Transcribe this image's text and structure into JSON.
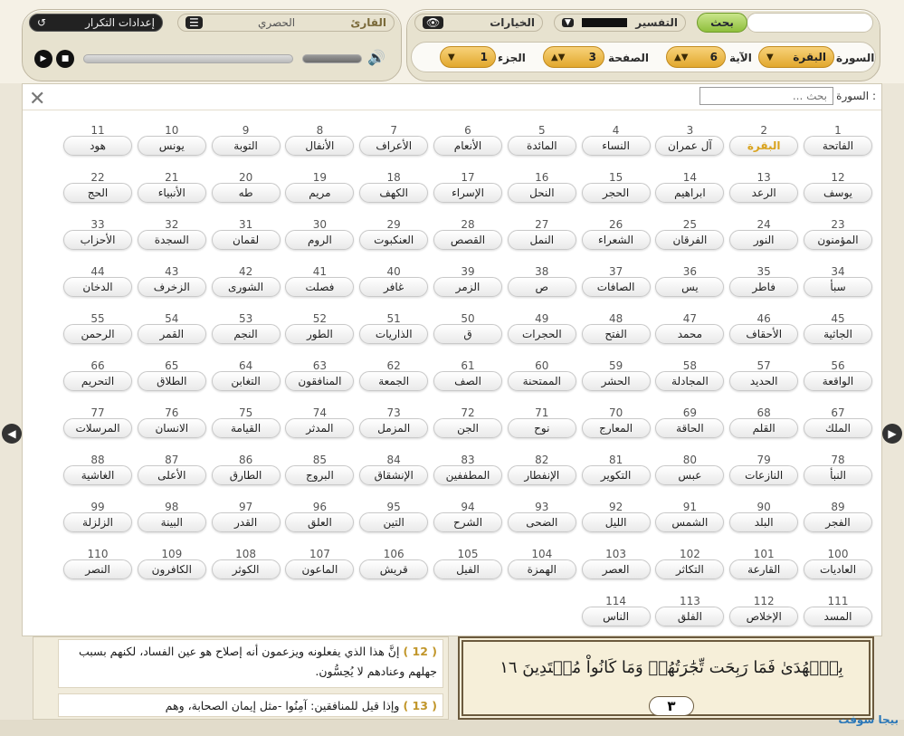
{
  "toolbar": {
    "search_btn": "بحث",
    "tafsir_label": "التفسير",
    "tafsir_value": "",
    "options_label": "الخيارات",
    "reader_label": "القارئ",
    "reader_value": "الحصري",
    "repeat_settings": "إعدادات التكرار",
    "sura_label": "السورة",
    "sura_value": "البقرة",
    "aya_label": "الآية",
    "aya_value": "6",
    "page_label": "الصفحة",
    "page_value": "3",
    "juz_label": "الجزء",
    "juz_value": "1"
  },
  "panel": {
    "search_label": "السورة :",
    "search_placeholder": "بحث ..."
  },
  "suras": [
    {
      "n": "1",
      "name": "الفاتحة"
    },
    {
      "n": "2",
      "name": "البقرة"
    },
    {
      "n": "3",
      "name": "آل عمران"
    },
    {
      "n": "4",
      "name": "النساء"
    },
    {
      "n": "5",
      "name": "المائدة"
    },
    {
      "n": "6",
      "name": "الأنعام"
    },
    {
      "n": "7",
      "name": "الأعراف"
    },
    {
      "n": "8",
      "name": "الأنفال"
    },
    {
      "n": "9",
      "name": "التوبة"
    },
    {
      "n": "10",
      "name": "يونس"
    },
    {
      "n": "11",
      "name": "هود"
    },
    {
      "n": "12",
      "name": "يوسف"
    },
    {
      "n": "13",
      "name": "الرعد"
    },
    {
      "n": "14",
      "name": "ابراهيم"
    },
    {
      "n": "15",
      "name": "الحجر"
    },
    {
      "n": "16",
      "name": "النحل"
    },
    {
      "n": "17",
      "name": "الإسراء"
    },
    {
      "n": "18",
      "name": "الكهف"
    },
    {
      "n": "19",
      "name": "مريم"
    },
    {
      "n": "20",
      "name": "طه"
    },
    {
      "n": "21",
      "name": "الأنبياء"
    },
    {
      "n": "22",
      "name": "الحج"
    },
    {
      "n": "23",
      "name": "المؤمنون"
    },
    {
      "n": "24",
      "name": "النور"
    },
    {
      "n": "25",
      "name": "الفرقان"
    },
    {
      "n": "26",
      "name": "الشعراء"
    },
    {
      "n": "27",
      "name": "النمل"
    },
    {
      "n": "28",
      "name": "القصص"
    },
    {
      "n": "29",
      "name": "العنكبوت"
    },
    {
      "n": "30",
      "name": "الروم"
    },
    {
      "n": "31",
      "name": "لقمان"
    },
    {
      "n": "32",
      "name": "السجدة"
    },
    {
      "n": "33",
      "name": "الأحزاب"
    },
    {
      "n": "34",
      "name": "سبأ"
    },
    {
      "n": "35",
      "name": "فاطر"
    },
    {
      "n": "36",
      "name": "يس"
    },
    {
      "n": "37",
      "name": "الصافات"
    },
    {
      "n": "38",
      "name": "ص"
    },
    {
      "n": "39",
      "name": "الزمر"
    },
    {
      "n": "40",
      "name": "غافر"
    },
    {
      "n": "41",
      "name": "فصلت"
    },
    {
      "n": "42",
      "name": "الشورى"
    },
    {
      "n": "43",
      "name": "الزخرف"
    },
    {
      "n": "44",
      "name": "الدخان"
    },
    {
      "n": "45",
      "name": "الجاثية"
    },
    {
      "n": "46",
      "name": "الأحقاف"
    },
    {
      "n": "47",
      "name": "محمد"
    },
    {
      "n": "48",
      "name": "الفتح"
    },
    {
      "n": "49",
      "name": "الحجرات"
    },
    {
      "n": "50",
      "name": "ق"
    },
    {
      "n": "51",
      "name": "الذاريات"
    },
    {
      "n": "52",
      "name": "الطور"
    },
    {
      "n": "53",
      "name": "النجم"
    },
    {
      "n": "54",
      "name": "القمر"
    },
    {
      "n": "55",
      "name": "الرحمن"
    },
    {
      "n": "56",
      "name": "الواقعة"
    },
    {
      "n": "57",
      "name": "الحديد"
    },
    {
      "n": "58",
      "name": "المجادلة"
    },
    {
      "n": "59",
      "name": "الحشر"
    },
    {
      "n": "60",
      "name": "الممتحنة"
    },
    {
      "n": "61",
      "name": "الصف"
    },
    {
      "n": "62",
      "name": "الجمعة"
    },
    {
      "n": "63",
      "name": "المنافقون"
    },
    {
      "n": "64",
      "name": "التغابن"
    },
    {
      "n": "65",
      "name": "الطلاق"
    },
    {
      "n": "66",
      "name": "التحريم"
    },
    {
      "n": "67",
      "name": "الملك"
    },
    {
      "n": "68",
      "name": "القلم"
    },
    {
      "n": "69",
      "name": "الحاقة"
    },
    {
      "n": "70",
      "name": "المعارج"
    },
    {
      "n": "71",
      "name": "نوح"
    },
    {
      "n": "72",
      "name": "الجن"
    },
    {
      "n": "73",
      "name": "المزمل"
    },
    {
      "n": "74",
      "name": "المدثر"
    },
    {
      "n": "75",
      "name": "القيامة"
    },
    {
      "n": "76",
      "name": "الانسان"
    },
    {
      "n": "77",
      "name": "المرسلات"
    },
    {
      "n": "78",
      "name": "النبأ"
    },
    {
      "n": "79",
      "name": "النازعات"
    },
    {
      "n": "80",
      "name": "عبس"
    },
    {
      "n": "81",
      "name": "التكوير"
    },
    {
      "n": "82",
      "name": "الإنفطار"
    },
    {
      "n": "83",
      "name": "المطففين"
    },
    {
      "n": "84",
      "name": "الإنشقاق"
    },
    {
      "n": "85",
      "name": "البروج"
    },
    {
      "n": "86",
      "name": "الطارق"
    },
    {
      "n": "87",
      "name": "الأعلى"
    },
    {
      "n": "88",
      "name": "الغاشية"
    },
    {
      "n": "89",
      "name": "الفجر"
    },
    {
      "n": "90",
      "name": "البلد"
    },
    {
      "n": "91",
      "name": "الشمس"
    },
    {
      "n": "92",
      "name": "الليل"
    },
    {
      "n": "93",
      "name": "الضحى"
    },
    {
      "n": "94",
      "name": "الشرح"
    },
    {
      "n": "95",
      "name": "التين"
    },
    {
      "n": "96",
      "name": "العلق"
    },
    {
      "n": "97",
      "name": "القدر"
    },
    {
      "n": "98",
      "name": "البينة"
    },
    {
      "n": "99",
      "name": "الزلزلة"
    },
    {
      "n": "100",
      "name": "العاديات"
    },
    {
      "n": "101",
      "name": "القارعة"
    },
    {
      "n": "102",
      "name": "التكاثر"
    },
    {
      "n": "103",
      "name": "العصر"
    },
    {
      "n": "104",
      "name": "الهمزة"
    },
    {
      "n": "105",
      "name": "الفيل"
    },
    {
      "n": "106",
      "name": "قريش"
    },
    {
      "n": "107",
      "name": "الماعون"
    },
    {
      "n": "108",
      "name": "الكوثر"
    },
    {
      "n": "109",
      "name": "الكافرون"
    },
    {
      "n": "110",
      "name": "النصر"
    },
    {
      "n": "111",
      "name": "المسد"
    },
    {
      "n": "112",
      "name": "الإخلاص"
    },
    {
      "n": "113",
      "name": "الفلق"
    },
    {
      "n": "114",
      "name": "الناس"
    }
  ],
  "active_sura": "2",
  "tafsir": {
    "v1_num": "( 12 )",
    "v1_text": "إنَّ هذا الذي يفعلونه ويزعمون أنه إصلاح هو عين الفساد، لكنهم بسبب جهلهم وعنادهم لا يُحِسُّون.",
    "v2_num": "( 13 )",
    "v2_text": "وإذا قيل للمنافقين: آمِنُوا -مثل إيمان الصحابة، وهم"
  },
  "mushaf": {
    "line1": "بِٱلۡهُدَىٰ فَمَا رَبِحَت تِّجَٰرَتُهُمۡ وَمَا كَانُواْ مُهۡتَدِينَ ١٦",
    "page_number": "٣"
  },
  "logo_text": "بيجا سوفت"
}
